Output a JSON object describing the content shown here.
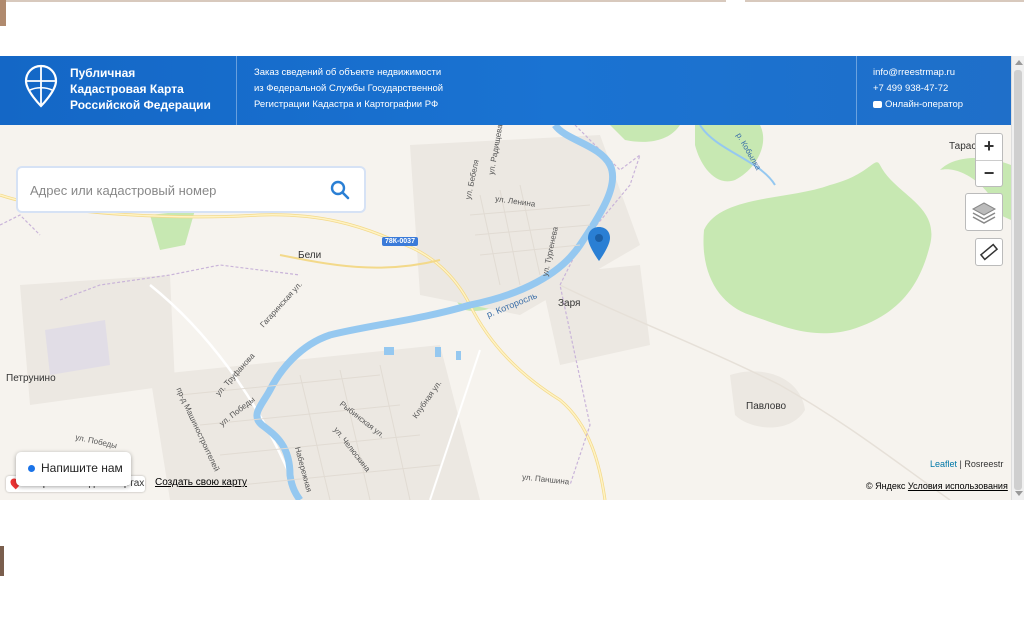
{
  "header": {
    "brand_line1": "Публичная",
    "brand_line2": "Кадастровая Карта",
    "brand_line3": "Российской Федерации",
    "desc_line1": "Заказ сведений об объекте недвижимости",
    "desc_line2": "из Федеральной Службы Государственной",
    "desc_line3": "Регистрации Кадастра и Картографии РФ",
    "email": "info@rreestrmap.ru",
    "phone": "+7 499 938-47-72",
    "chat": "Онлайн-оператор"
  },
  "search": {
    "placeholder": "Адрес или кадастровый номер"
  },
  "map_controls": {
    "zoom_in": "+",
    "zoom_out": "−"
  },
  "map_labels": {
    "beli": "Бели",
    "zarya": "Заря",
    "petrunino": "Петрунино",
    "pavlovo": "Павлово",
    "tarasi": "Тарас",
    "road_badge": "78К-0037",
    "river": "р. Которосль",
    "kobylka": "р. Кобылка",
    "ul_lenina": "ул. Ленина",
    "ul_bebelya": "ул. Бебеля",
    "ul_radishcheva": "ул. Радищева",
    "ul_turgeneva": "ул. Тургенева",
    "gagarinskaya": "Гагаринская ул.",
    "ul_trufanova": "ул. Труфанова",
    "ul_pobedy1": "ул. Победы",
    "ul_pobedy2": "ул. Победы",
    "mashinostroiteley": "пр-д Машиностроителей",
    "rybinskaya": "Рыбинская ул.",
    "klubnaya": "Клубная ул.",
    "chelyuskina": "ул. Челюскина",
    "naberezhnaya": "Набережная",
    "ul_panshina": "ул. Паншина"
  },
  "footer": {
    "write_us": "Напишите нам",
    "open_yandex": "Открыть в Яндекс.Картах",
    "create_map": "Создать свою карту",
    "leaflet": "Leaflet",
    "rosreestr": "Rosreestr",
    "yandex_copy": "© Яндекс",
    "terms": "Условия использования"
  },
  "colors": {
    "header_blue": "#1a73d2",
    "river": "#8cc4ee",
    "forest": "#bfe6a8",
    "marker": "#2a7fd4"
  }
}
